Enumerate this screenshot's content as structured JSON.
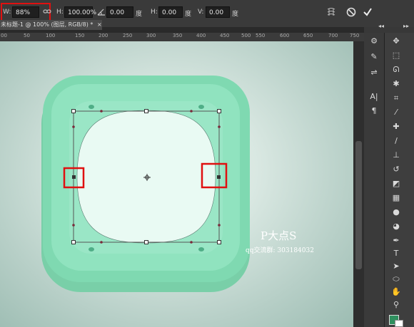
{
  "options_bar": {
    "width_label": "W:",
    "width_value": "88%",
    "height_label": "H:",
    "height_value": "100.00%",
    "rotate_value": "0.00",
    "rotate_unit": "度",
    "hskew_label": "H:",
    "hskew_value": "0.00",
    "hskew_unit": "度",
    "vskew_label": "V:",
    "vskew_value": "0.00",
    "vskew_unit": "度"
  },
  "document_tab": {
    "title": "未标题-1 @ 100% (图层, RGB/8) *",
    "close": "×"
  },
  "ruler": {
    "ticks": [
      "00",
      "50",
      "100",
      "150",
      "200",
      "250",
      "300",
      "350",
      "400",
      "450",
      "500",
      "550",
      "600",
      "650",
      "700",
      "750"
    ]
  },
  "watermark": {
    "brand": "P大点S",
    "qq_group": "qq交流群: 303184032"
  },
  "colors": {
    "icon_outer": "#7fd9b1",
    "icon_mid": "#90e3bf",
    "icon_inner": "#9ae6c6",
    "icon_face": "#e9faf3",
    "highlight_box": "#e01010",
    "foreground_swatch": "#2f8f5e"
  },
  "icons": {
    "link": "link-icon",
    "cancel": "cancel-icon",
    "commit": "checkmark-icon",
    "warp": "warp-icon",
    "move": "move-tool-icon",
    "marquee": "marquee-tool-icon",
    "lasso": "lasso-tool-icon",
    "magic_wand": "magic-wand-icon",
    "crop": "crop-tool-icon",
    "eyedropper": "eyedropper-icon",
    "healing": "healing-brush-icon",
    "brush": "brush-tool-icon",
    "stamp": "clone-stamp-icon",
    "history_brush": "history-brush-icon",
    "eraser": "eraser-icon",
    "gradient": "gradient-tool-icon",
    "blur": "blur-tool-icon",
    "dodge": "dodge-tool-icon",
    "pen": "pen-tool-icon",
    "type": "type-tool-icon",
    "path_select": "path-selection-icon",
    "shape": "ellipse-tool-icon",
    "hand": "hand-tool-icon",
    "zoom": "zoom-tool-icon"
  },
  "panel_labels": {
    "character": "A|",
    "paragraph": "¶",
    "type_tool": "T"
  }
}
